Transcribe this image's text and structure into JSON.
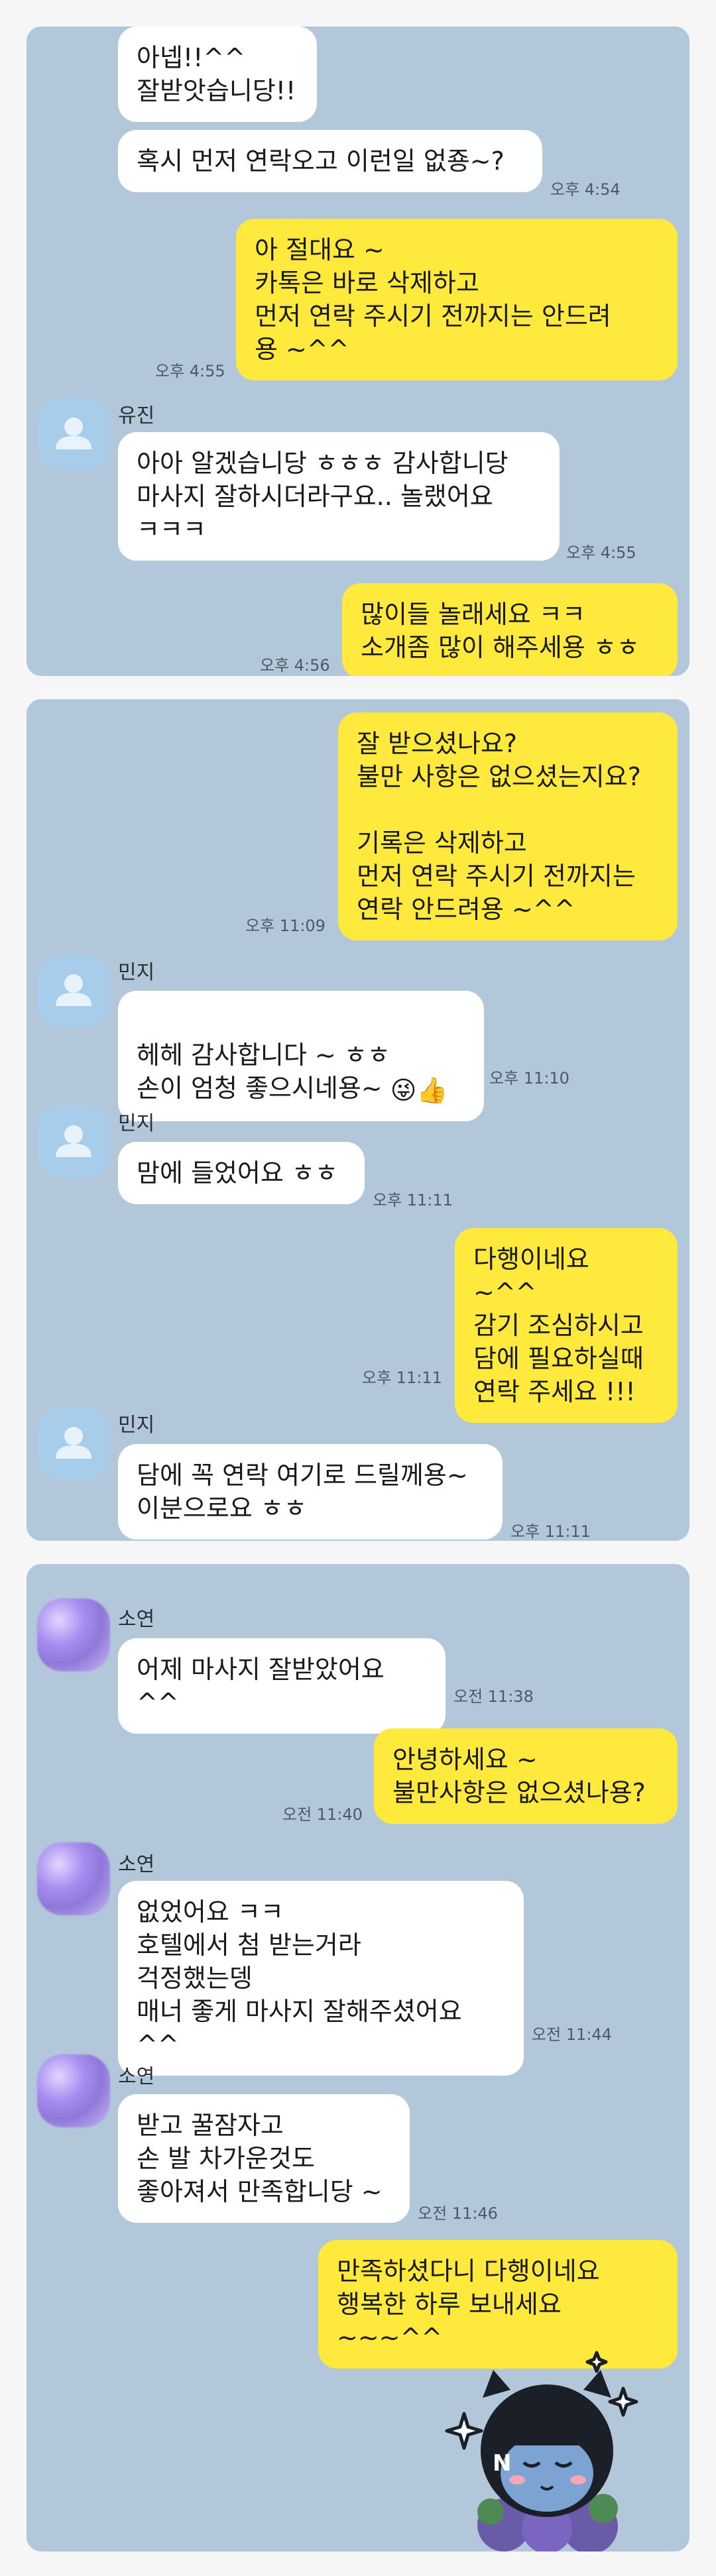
{
  "panel1": {
    "bubble_a": "아넵!!^^\n잘받앗습니당!!",
    "bubble_b": "혹시 먼저 연락오고 이런일 없죵~?",
    "time_b": "오후 4:54",
    "bubble_c": "아 절대요 ~\n카톡은 바로 삭제하고\n먼저 연락 주시기 전까지는 안드려\n용 ~^^",
    "time_c": "오후 4:55",
    "sender_1": "유진",
    "bubble_d": "아아 알겠습니당 ㅎㅎㅎ 감사합니당\n마사지 잘하시더라구요.. 놀랬어요\nㅋㅋㅋ",
    "time_d": "오후 4:55",
    "bubble_e": "많이들 놀래세요 ㅋㅋ\n소개좀 많이 해주세용 ㅎㅎ",
    "time_e": "오후 4:56"
  },
  "panel2": {
    "bubble_a": "잘 받으셨나요?\n불만 사항은 없으셨는지요?\n\n기록은 삭제하고\n먼저 연락 주시기 전까지는\n연락 안드려용 ~^^",
    "time_a": "오후 11:09",
    "sender_1": "민지",
    "bubble_b_text": "헤헤 감사합니다 ~ ㅎㅎ\n손이 엄청 좋으시네용~ ",
    "bubble_b_emoji": "😜👍",
    "time_b": "오후 11:10",
    "sender_2": "민지",
    "bubble_c": "맘에 들었어요 ㅎㅎ",
    "time_c": "오후 11:11",
    "bubble_d": "다행이네요 ~^^\n감기 조심하시고\n담에 필요하실때\n연락 주세요 !!!",
    "time_d": "오후 11:11",
    "sender_3": "민지",
    "bubble_e": "담에 꼭 연락 여기로 드릴께용~\n이분으로요 ㅎㅎ",
    "time_e": "오후 11:11"
  },
  "panel3": {
    "sender_1": "소연",
    "bubble_a": "어제 마사지 잘받았어요 ^^",
    "time_a": "오전 11:38",
    "bubble_b": "안녕하세요 ~\n불만사항은 없으셨나용?",
    "time_b": "오전 11:40",
    "sender_2": "소연",
    "bubble_c": "없었어요 ㅋㅋ\n호텔에서 첨 받는거라\n걱정했는뎅\n매너 좋게 마사지 잘해주셨어요 ^^",
    "time_c": "오전 11:44",
    "sender_3": "소연",
    "bubble_d": "받고 꿀잠자고\n손 발 차가운것도\n좋아져서 만족합니당 ~",
    "time_d": "오전 11:46",
    "bubble_e": "만족하셨다니 다행이네요\n행복한 하루 보내세요 ~~~^^"
  },
  "colors": {
    "chat_bg": "#b2c7da",
    "my_bubble": "#fee93c",
    "their_bubble": "#ffffff"
  },
  "icons": {
    "default_avatar": "person-silhouette-icon",
    "sticker": "cartoon-character-sticker"
  }
}
